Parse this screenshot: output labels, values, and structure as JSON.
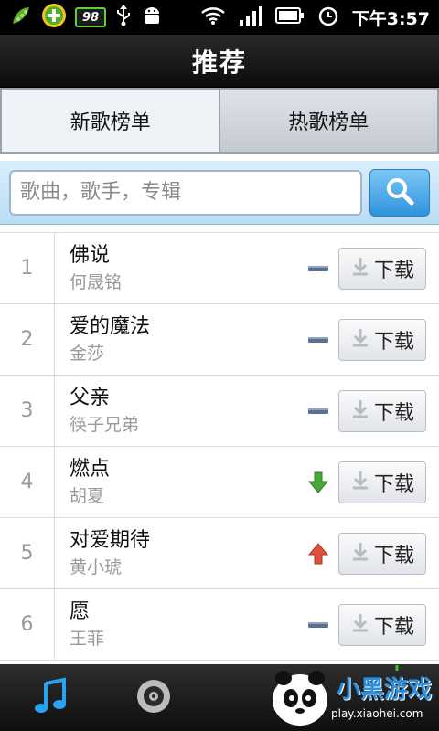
{
  "status_bar": {
    "battery_level": "98",
    "time": "下午3:57"
  },
  "header": {
    "title": "推荐"
  },
  "tabs": [
    {
      "label": "新歌榜单",
      "active": true
    },
    {
      "label": "热歌榜单",
      "active": false
    }
  ],
  "search": {
    "placeholder": "歌曲，歌手，专辑",
    "value": ""
  },
  "songs": [
    {
      "rank": "1",
      "title": "佛说",
      "artist": "何晟铭",
      "trend": "same",
      "download_label": "下载"
    },
    {
      "rank": "2",
      "title": "爱的魔法",
      "artist": "金莎",
      "trend": "same",
      "download_label": "下载"
    },
    {
      "rank": "3",
      "title": "父亲",
      "artist": "筷子兄弟",
      "trend": "same",
      "download_label": "下载"
    },
    {
      "rank": "4",
      "title": "燃点",
      "artist": "胡夏",
      "trend": "down",
      "download_label": "下载"
    },
    {
      "rank": "5",
      "title": "对爱期待",
      "artist": "黄小琥",
      "trend": "up",
      "download_label": "下载"
    },
    {
      "rank": "6",
      "title": "愿",
      "artist": "王菲",
      "trend": "same",
      "download_label": "下载"
    }
  ],
  "colors": {
    "trend_same": "#5b6f8e",
    "trend_up": "#e0503c",
    "trend_down": "#4aa63c",
    "accent": "#2f93dc"
  },
  "bottom_nav": [
    "music-note-icon",
    "disc-icon"
  ],
  "watermark": {
    "main": "小黑游戏",
    "domain": "play.xiaohei.com"
  }
}
